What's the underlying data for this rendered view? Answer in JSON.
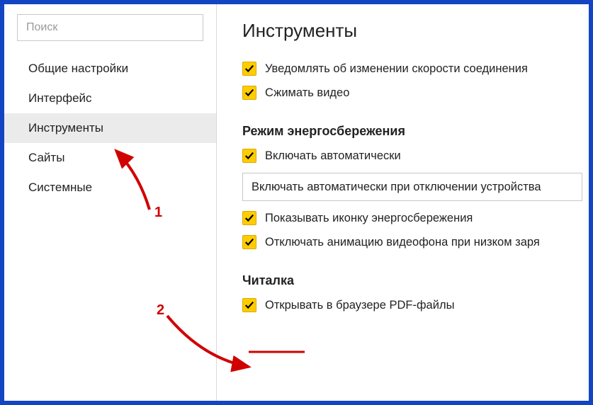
{
  "search": {
    "placeholder": "Поиск"
  },
  "sidebar": {
    "items": [
      {
        "label": "Общие настройки"
      },
      {
        "label": "Интерфейс"
      },
      {
        "label": "Инструменты"
      },
      {
        "label": "Сайты"
      },
      {
        "label": "Системные"
      }
    ]
  },
  "main": {
    "title": "Инструменты",
    "top_options": [
      {
        "label": "Уведомлять об изменении скорости соединения"
      },
      {
        "label": "Сжимать видео"
      }
    ],
    "energy": {
      "title": "Режим энергосбережения",
      "auto_label": "Включать автоматически",
      "dropdown_value": "Включать автоматически при отключении устройства",
      "icon_label": "Показывать иконку энергосбережения",
      "anim_label": "Отключать анимацию видеофона при низком заря"
    },
    "reader": {
      "title": "Читалка",
      "pdf_label": "Открывать в браузере PDF-файлы"
    }
  },
  "annotations": {
    "num1": "1",
    "num2": "2"
  }
}
